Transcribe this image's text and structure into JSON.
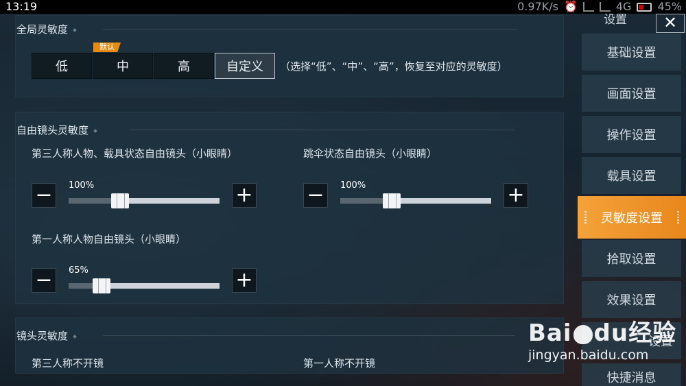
{
  "status_bar": {
    "time": "13:19",
    "net_speed": "0.97K/s",
    "network": "4G",
    "battery": "45%"
  },
  "sidebar": {
    "header_label": "设置",
    "close_label": "✕",
    "items": [
      {
        "label": "基础设置"
      },
      {
        "label": "画面设置"
      },
      {
        "label": "操作设置"
      },
      {
        "label": "载具设置"
      },
      {
        "label": "灵敏度设置",
        "active": true
      },
      {
        "label": "拾取设置"
      },
      {
        "label": "效果设置"
      },
      {
        "label": "设置"
      },
      {
        "label": "快捷消息"
      }
    ]
  },
  "global": {
    "title": "全局灵敏度",
    "default_tag": "默认",
    "presets": [
      "低",
      "中",
      "高",
      "自定义"
    ],
    "hint": "（选择“低”、“中”、“高”，恢复至对应的灵敏度）"
  },
  "free_look": {
    "title": "自由镜头灵敏度",
    "sliders": [
      {
        "label": "第三人称人物、载具状态自由镜头（小眼睛）",
        "value_text": "100%",
        "fraction": 0.34
      },
      {
        "label": "跳伞状态自由镜头（小眼睛）",
        "value_text": "100%",
        "fraction": 0.34
      },
      {
        "label": "第一人称人物自由镜头（小眼睛）",
        "value_text": "65%",
        "fraction": 0.22
      }
    ],
    "minus_label": "−",
    "plus_label": "+"
  },
  "lens": {
    "title": "镜头灵敏度",
    "col1": "第三人称不开镜",
    "col2": "第一人称不开镜"
  },
  "watermark": {
    "logo": "Bai",
    "logo2": "du",
    "logo3": "经验",
    "url": "jingyan.baidu.com"
  }
}
